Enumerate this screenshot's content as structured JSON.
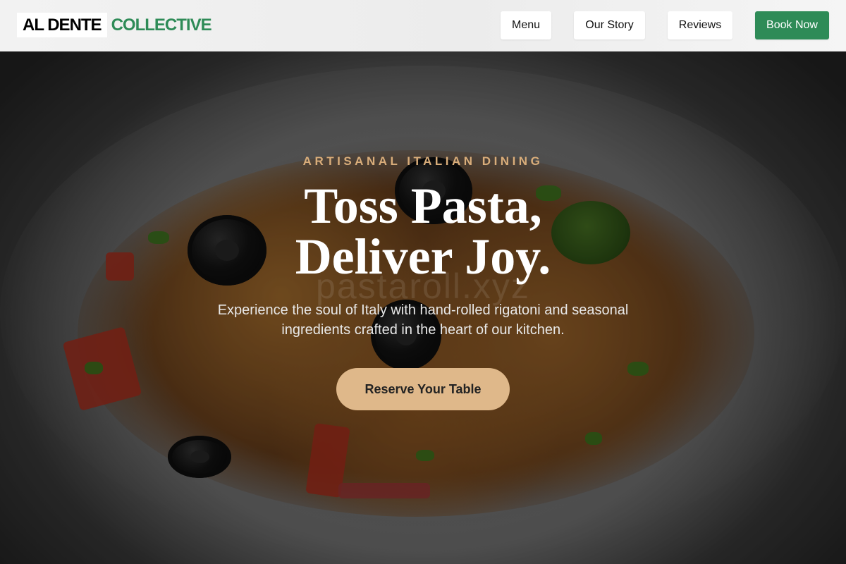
{
  "brand": {
    "part1": "AL DENTE",
    "part2": "COLLECTIVE",
    "accent_color": "#2e8b57"
  },
  "nav": {
    "items": [
      {
        "label": "Menu"
      },
      {
        "label": "Our Story"
      },
      {
        "label": "Reviews"
      }
    ],
    "book_label": "Book Now"
  },
  "hero": {
    "eyebrow": "ARTISANAL ITALIAN DINING",
    "headline_line1": "Toss Pasta,",
    "headline_line2": "Deliver Joy.",
    "watermark": "pastaroll.xyz",
    "subtitle": "Experience the soul of Italy with hand-rolled rigatoni and seasonal ingredients crafted in the heart of our kitchen.",
    "cta_label": "Reserve Your Table",
    "eyebrow_color": "#d9ad7a",
    "cta_color": "#dfb88a"
  }
}
